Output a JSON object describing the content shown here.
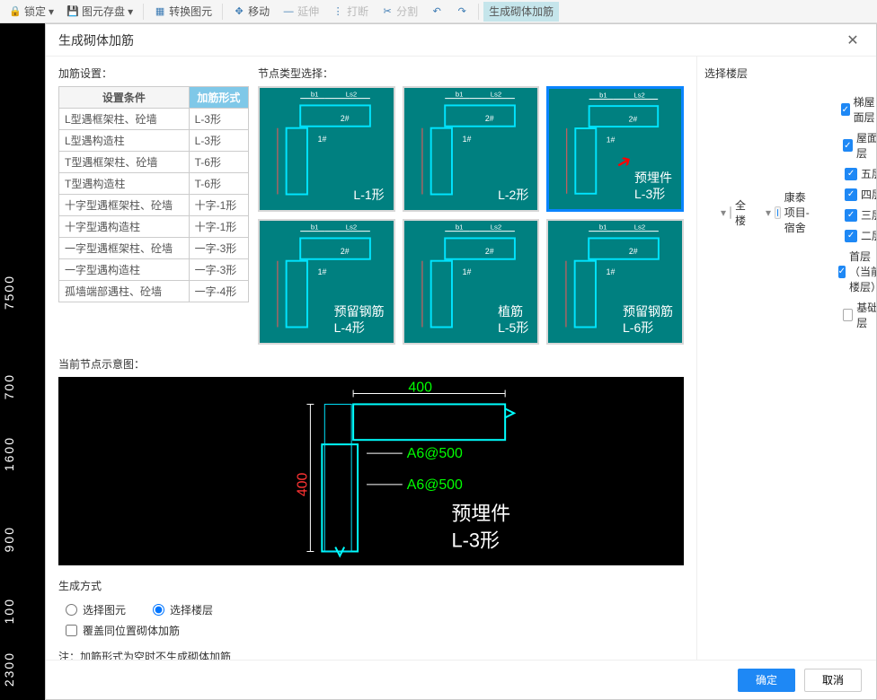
{
  "ribbon": {
    "lock": "锁定",
    "store": "图元存盘",
    "convert": "转换图元",
    "move": "移动",
    "extend": "延伸",
    "break": "打断",
    "split": "分割",
    "undo": "",
    "redo": "",
    "active": "生成砌体加筋"
  },
  "canvasRuler": [
    "7500",
    "700",
    "1600",
    "900",
    "100",
    "2300"
  ],
  "modal": {
    "title": "生成砌体加筋",
    "settings_label": "加筋设置：",
    "table_headers": {
      "cond": "设置条件",
      "form": "加筋形式"
    },
    "rows": [
      {
        "cond": "L型遇框架柱、砼墙",
        "form": "L-3形"
      },
      {
        "cond": "L型遇构造柱",
        "form": "L-3形"
      },
      {
        "cond": "T型遇框架柱、砼墙",
        "form": "T-6形"
      },
      {
        "cond": "T型遇构造柱",
        "form": "T-6形"
      },
      {
        "cond": "十字型遇框架柱、砼墙",
        "form": "十字-1形"
      },
      {
        "cond": "十字型遇构造柱",
        "form": "十字-1形"
      },
      {
        "cond": "一字型遇框架柱、砼墙",
        "form": "一字-3形"
      },
      {
        "cond": "一字型遇构造柱",
        "form": "一字-3形"
      },
      {
        "cond": "孤墙端部遇柱、砼墙",
        "form": "一字-4形"
      }
    ],
    "nodetype_label": "节点类型选择：",
    "cards": [
      {
        "name": "card-l1",
        "cap1": "",
        "cap2": "L-1形"
      },
      {
        "name": "card-l2",
        "cap1": "",
        "cap2": "L-2形"
      },
      {
        "name": "card-l3",
        "cap1": "预埋件",
        "cap2": "L-3形",
        "sel": true
      },
      {
        "name": "card-l4",
        "cap1": "预留钢筋",
        "cap2": "L-4形"
      },
      {
        "name": "card-l5",
        "cap1": "植筋",
        "cap2": "L-5形"
      },
      {
        "name": "card-l6",
        "cap1": "预留钢筋",
        "cap2": "L-6形"
      }
    ],
    "schem_label": "当前节点示意图：",
    "schem": {
      "d1": "400",
      "d2": "400",
      "t1": "A6@500",
      "t2": "A6@500",
      "cap1": "预埋件",
      "cap2": "L-3形"
    },
    "gen_label": "生成方式",
    "radio1": "选择图元",
    "radio2": "选择楼层",
    "chk": "覆盖同位置砌体加筋",
    "note": "注：加筋形式为空时不生成砌体加筋"
  },
  "floors": {
    "label": "选择楼层",
    "root": "全楼",
    "proj": "康泰项目-宿舍",
    "items": [
      {
        "label": "梯屋面层",
        "chk": true
      },
      {
        "label": "屋面层",
        "chk": true
      },
      {
        "label": "五层",
        "chk": true
      },
      {
        "label": "四层",
        "chk": true
      },
      {
        "label": "三层",
        "chk": true
      },
      {
        "label": "二层",
        "chk": true
      },
      {
        "label": "首层（当前楼层）",
        "chk": true
      },
      {
        "label": "基础层",
        "chk": false
      }
    ]
  },
  "footer": {
    "ok": "确定",
    "cancel": "取消"
  }
}
